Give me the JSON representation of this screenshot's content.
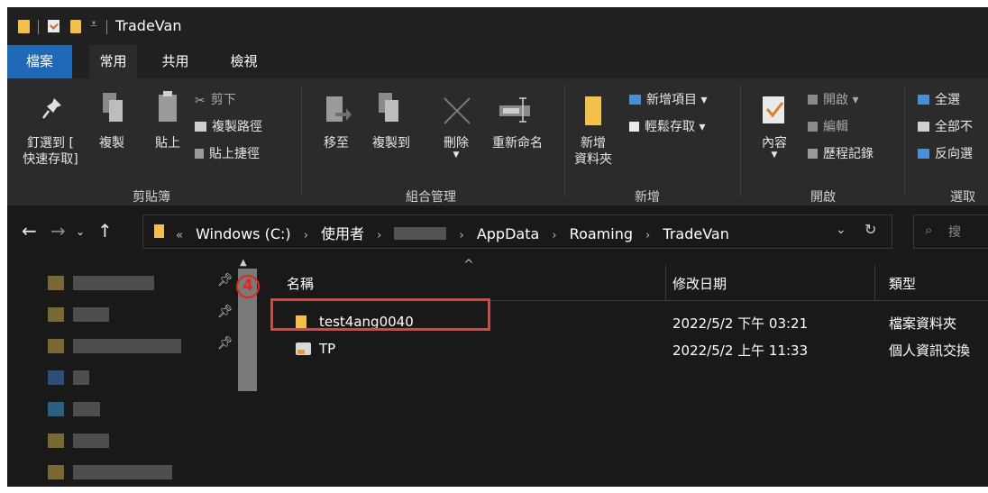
{
  "window": {
    "title": "TradeVan"
  },
  "tabs": [
    {
      "label": "檔案"
    },
    {
      "label": "常用"
    },
    {
      "label": "共用"
    },
    {
      "label": "檢視"
    }
  ],
  "ribbon": {
    "clipboard": {
      "pin_label": "釘選到 [\n快速存取]",
      "copy_label": "複製",
      "paste_label": "貼上",
      "cut_label": "剪下",
      "copy_path_label": "複製路徑",
      "paste_shortcut_label": "貼上捷徑",
      "group_label": "剪貼簿"
    },
    "organize": {
      "move_to_label": "移至",
      "copy_to_label": "複製到",
      "delete_label": "刪除",
      "rename_label": "重新命名",
      "group_label": "組合管理"
    },
    "new": {
      "new_folder_label": "新增\n資料夾",
      "new_item_label": "新增項目 ▾",
      "easy_access_label": "輕鬆存取 ▾",
      "group_label": "新增"
    },
    "open": {
      "properties_label": "內容",
      "open_label": "開啟 ▾",
      "edit_label": "編輯",
      "history_label": "歷程記錄",
      "group_label": "開啟"
    },
    "select": {
      "select_all_label": "全選",
      "select_none_label": "全部不",
      "invert_label": "反向選",
      "group_label": "選取"
    }
  },
  "address": {
    "overflow": "«",
    "crumbs": [
      "Windows (C:)",
      "使用者",
      "AppData",
      "Roaming",
      "TradeVan"
    ],
    "search_placeholder": "搜"
  },
  "columns": {
    "name": "名稱",
    "date": "修改日期",
    "type": "類型"
  },
  "files": [
    {
      "name": "test4ang0040",
      "date": "2022/5/2 下午 03:21",
      "type": "檔案資料夾"
    },
    {
      "name": "TP",
      "date": "2022/5/2 上午 11:33",
      "type": "個人資訊交換"
    }
  ],
  "annotation": {
    "step": "4"
  },
  "colors": {
    "folder": "#f3c04c",
    "file_tab": "#1f68b5",
    "highlight": "#c0504d",
    "badge": "#e0281b"
  }
}
